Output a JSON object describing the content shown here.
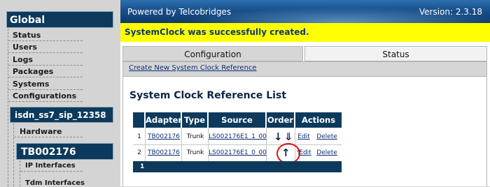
{
  "sidebar": {
    "root_label": "Global",
    "items": [
      {
        "label": "Status"
      },
      {
        "label": "Users"
      },
      {
        "label": "Logs"
      },
      {
        "label": "Packages"
      },
      {
        "label": "Systems"
      },
      {
        "label": "Configurations"
      }
    ],
    "config_name": "isdn_ss7_sip_12358",
    "hardware_label": "Hardware",
    "adapter_name": "TB002176",
    "adapter_items": [
      {
        "label": "IP Interfaces"
      },
      {
        "label": "Tdm Interfaces"
      }
    ]
  },
  "header": {
    "powered_by": "Powered by Telcobridges",
    "version": "Version: 2.3.18"
  },
  "notice": {
    "message": "SystemClock was successfully created."
  },
  "tabs": [
    {
      "label": "Configuration",
      "active": true
    },
    {
      "label": "Status",
      "active": false
    }
  ],
  "subnav": {
    "create_link": "Create New System Clock Reference"
  },
  "content": {
    "title": "System Clock Reference List"
  },
  "table": {
    "columns": [
      "",
      "Adapter",
      "Type",
      "Source",
      "Order",
      "Actions"
    ],
    "rows": [
      {
        "index": "1",
        "adapter": "TB002176",
        "type": "Trunk",
        "source": "LS002176E1_1_00",
        "order_icons": [
          "down-arrow-icon",
          "double-down-arrow-icon"
        ],
        "edit": "Edit",
        "delete": "Delete"
      },
      {
        "index": "2",
        "adapter": "TB002176",
        "type": "Trunk",
        "source": "LS002176E1_0_00",
        "order_icons": [
          "up-arrow-icon",
          "double-up-arrow-icon"
        ],
        "edit": "Edit",
        "delete": "Delete"
      }
    ],
    "footer": "1"
  },
  "colors": {
    "navy": "#0d3a5c",
    "notice_bg": "#ffff00",
    "highlight_circle": "#e01010"
  }
}
